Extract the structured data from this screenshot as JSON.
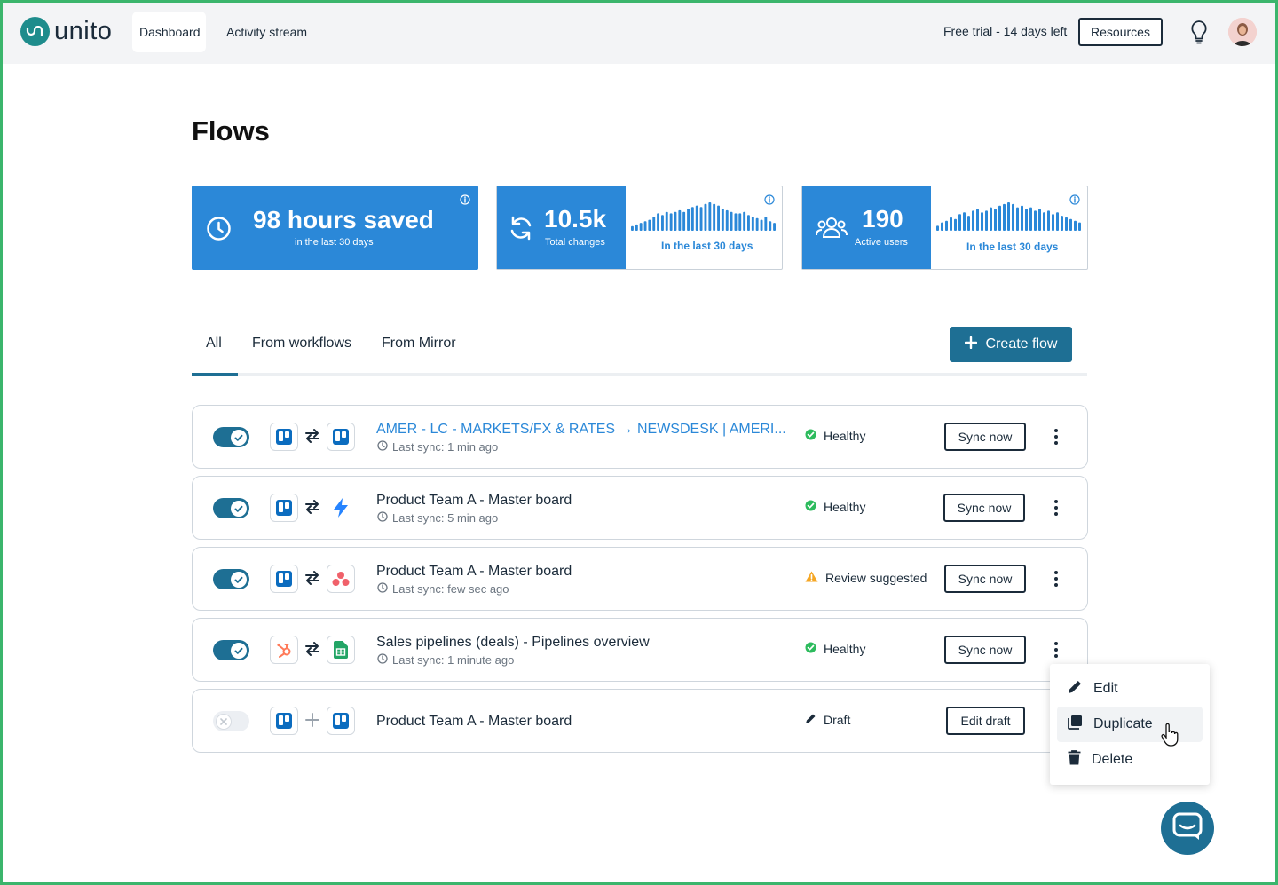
{
  "brand": {
    "name": "unito",
    "color": "#1e8c8c"
  },
  "nav": {
    "tabs": [
      {
        "label": "Dashboard",
        "active": true
      },
      {
        "label": "Activity stream",
        "active": false
      }
    ],
    "trial_text": "Free trial - 14 days left",
    "resources_label": "Resources",
    "help_icon": "lightbulb-icon",
    "avatar": "user-avatar"
  },
  "page": {
    "title": "Flows"
  },
  "stats": {
    "hours": {
      "value": "98 hours saved",
      "caption": "in the last 30 days"
    },
    "changes": {
      "value": "10.5k",
      "caption": "Total changes",
      "spark_label": "In the last 30 days",
      "bars": [
        3,
        4,
        5,
        6,
        7,
        9,
        11,
        10,
        12,
        11,
        12,
        13,
        12,
        14,
        15,
        16,
        15,
        17,
        18,
        17,
        16,
        14,
        13,
        12,
        11,
        11,
        12,
        10,
        9,
        8,
        7,
        9,
        6,
        5
      ]
    },
    "users": {
      "value": "190",
      "caption": "Active users",
      "spark_label": "In the last 30 days",
      "bars": [
        3,
        5,
        6,
        8,
        7,
        10,
        11,
        9,
        12,
        13,
        11,
        12,
        14,
        13,
        15,
        16,
        17,
        16,
        14,
        15,
        13,
        14,
        12,
        13,
        11,
        12,
        10,
        11,
        9,
        8,
        7,
        6,
        5
      ]
    },
    "bar_color": "#2b88d8"
  },
  "filters": {
    "tabs": [
      {
        "label": "All",
        "active": true
      },
      {
        "label": "From workflows",
        "active": false
      },
      {
        "label": "From Mirror",
        "active": false
      }
    ],
    "create_label": "Create flow"
  },
  "flows": [
    {
      "name": "AMER - LC - MARKETS/FX & RATES → NEWSDESK | AMERI...",
      "sync": "Last sync: 1 min ago",
      "status": "Healthy",
      "action": "Sync now",
      "enabled": true,
      "apps": [
        "trello-icon",
        "trello-icon"
      ]
    },
    {
      "name": "Product Team A - Master board",
      "sync": "Last sync: 5 min ago",
      "status": "Healthy",
      "action": "Sync now",
      "enabled": true,
      "apps": [
        "trello-icon",
        "jira-icon"
      ]
    },
    {
      "name": "Product Team A - Master board",
      "sync": "Last sync: few sec ago",
      "status": "Review suggested",
      "action": "Sync now",
      "enabled": true,
      "apps": [
        "trello-icon",
        "asana-icon"
      ]
    },
    {
      "name": "Sales pipelines (deals) - Pipelines overview",
      "sync": "Last sync: 1 minute ago",
      "status": "Healthy",
      "action": "Sync now",
      "enabled": true,
      "apps": [
        "hubspot-icon",
        "google-sheets-icon"
      ]
    },
    {
      "name": "Product Team A - Master board",
      "sync": "",
      "status": "Draft",
      "action": "Edit draft",
      "enabled": false,
      "apps": [
        "trello-icon",
        "trello-icon"
      ]
    }
  ],
  "menu": {
    "items": [
      {
        "label": "Edit",
        "icon": "pencil-icon"
      },
      {
        "label": "Duplicate",
        "icon": "copy-icon"
      },
      {
        "label": "Delete",
        "icon": "trash-icon"
      }
    ]
  },
  "colors": {
    "primary": "#1e6f94",
    "accent_blue": "#2b88d8",
    "healthy": "#2dbb5d",
    "warning": "#f5a623"
  }
}
